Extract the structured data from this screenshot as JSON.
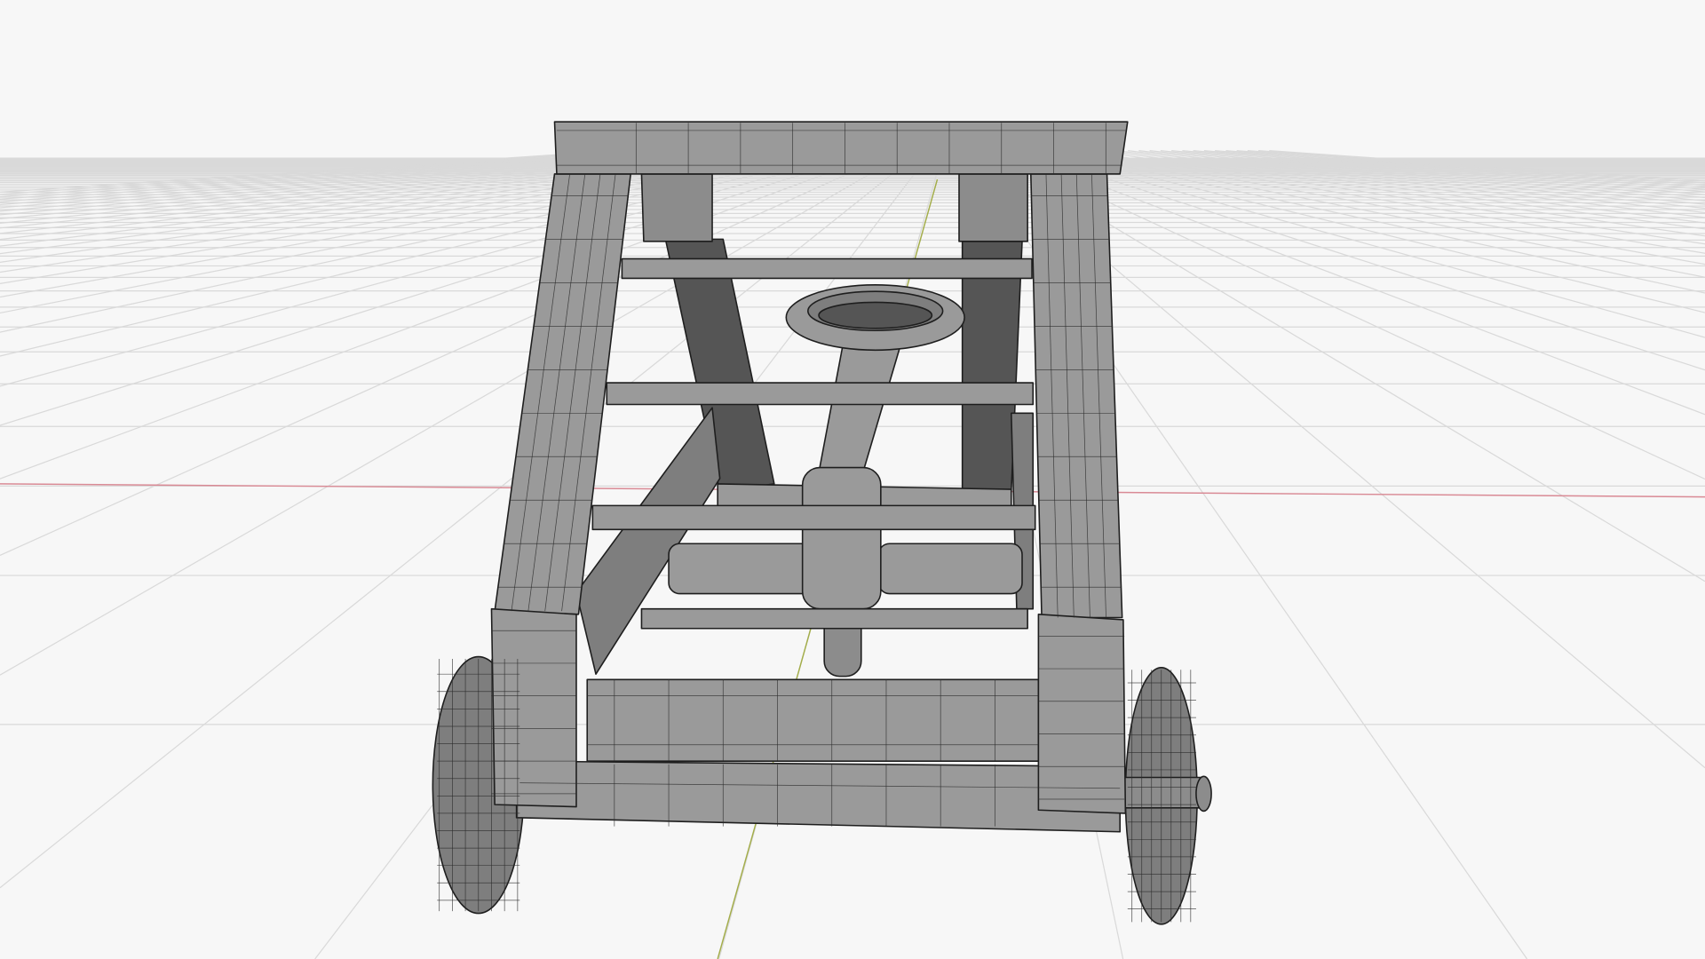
{
  "viewport": {
    "background": "#f7f7f7",
    "grid_color": "#d9d9d9",
    "x_axis_color": "#d98a95",
    "y_axis_color": "#a3ad4a",
    "model_color": "#8c8c8c",
    "wire_color": "#1e1e1e"
  }
}
